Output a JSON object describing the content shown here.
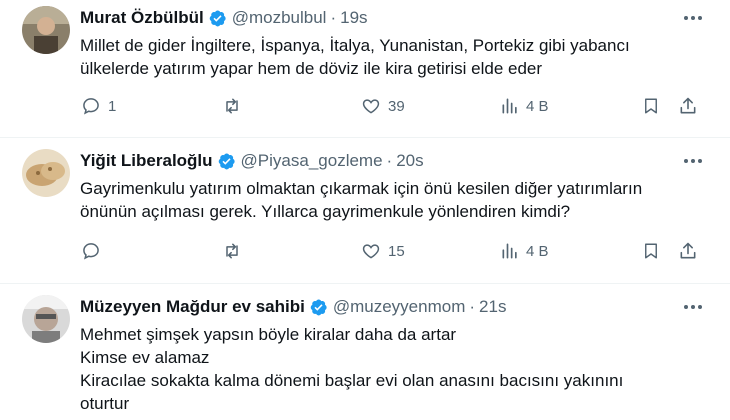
{
  "tweets": [
    {
      "name": "Murat Özbülbül",
      "handle": "@mozbulbul",
      "time": "19s",
      "lines": [
        "Millet de gider İngiltere, İspanya, İtalya, Yunanistan, Portekiz gibi yabancı",
        "ülkelerde yatırım yapar hem de döviz ile kira getirisi elde eder"
      ],
      "replies": "1",
      "retweets": "",
      "likes": "39",
      "views": "4 B"
    },
    {
      "name": "Yiğit Liberaloğlu",
      "handle": "@Piyasa_gozleme",
      "time": "20s",
      "lines": [
        "Gayrimenkulu yatırım olmaktan çıkarmak için önü kesilen diğer yatırımların",
        "önünün açılması gerek. Yıllarca gayrimenkule yönlendiren kimdi?"
      ],
      "replies": "",
      "retweets": "",
      "likes": "15",
      "views": "4 B"
    },
    {
      "name": "Müzeyyen Mağdur ev sahibi",
      "handle": "@muzeyyenmom",
      "time": "21s",
      "lines": [
        "Mehmet şimşek yapsın böyle kiralar daha da artar",
        "Kimse ev alamaz",
        "Kiracılae sokakta kalma dönemi başlar evi olan anasını bacısını yakınını",
        "oturtur"
      ]
    }
  ],
  "separator": "·",
  "icons": {
    "verified": "verified-badge-icon",
    "more": "more-icon",
    "reply": "reply-icon",
    "retweet": "retweet-icon",
    "like": "heart-icon",
    "views": "views-icon",
    "bookmark": "bookmark-icon",
    "share": "share-icon"
  },
  "colors": {
    "verified": "#1d9bf0",
    "secondary_text": "#536471",
    "text": "#0f1419"
  }
}
